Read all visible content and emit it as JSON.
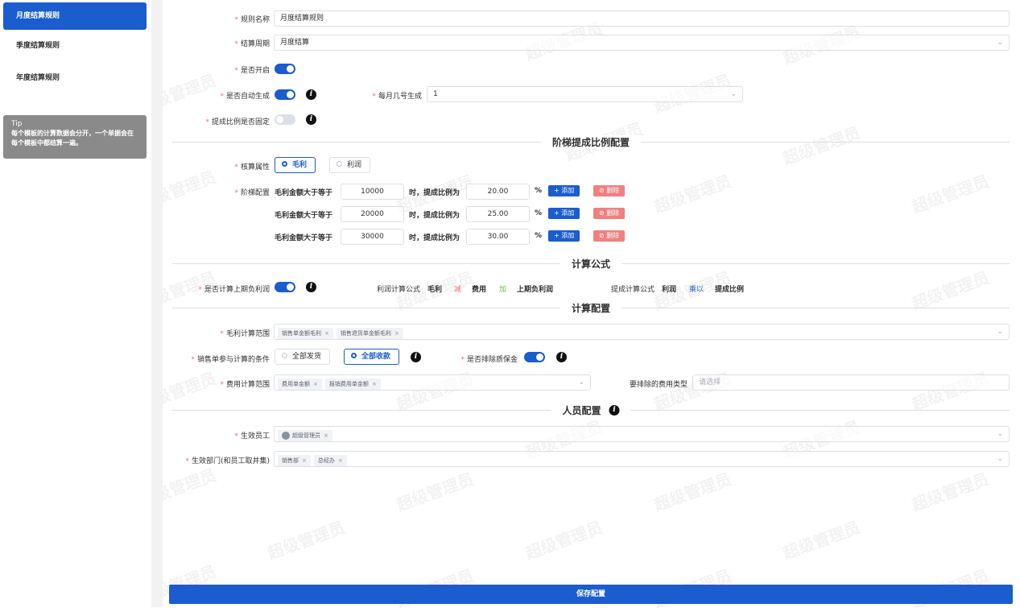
{
  "watermark": "超级管理员",
  "sidebar": {
    "items": [
      {
        "label": "月度结算规则",
        "active": true
      },
      {
        "label": "季度结算规则",
        "active": false
      },
      {
        "label": "年度结算规则",
        "active": false
      }
    ],
    "tip": {
      "title": "Tip",
      "text": "每个模板的计算数据会分开，一个单据会在每个模板中都结算一遍。"
    }
  },
  "form": {
    "rule_name": {
      "label": "规则名称",
      "value": "月度结算规则"
    },
    "period": {
      "label": "结算周期",
      "value": "月度结算"
    },
    "enabled": {
      "label": "是否开启",
      "on": true
    },
    "auto_generate": {
      "label": "是否自动生成",
      "on": true
    },
    "day_of_month": {
      "label": "每月几号生成",
      "value": "1"
    },
    "ratio_fixed": {
      "label": "提成比例是否固定",
      "on": false
    }
  },
  "tier_section": {
    "title": "阶梯提成比例配置",
    "attr_label": "核算属性",
    "options": [
      {
        "label": "毛利",
        "selected": true
      },
      {
        "label": "利润",
        "selected": false
      }
    ],
    "tier_label": "阶梯配置",
    "prefix": "毛利金额大于等于",
    "middle": "时，提成比例为",
    "suffix": "%",
    "add_label": "+ 添加",
    "delete_label": "⊘ 删除",
    "tiers": [
      {
        "amount": "10000",
        "ratio": "20.00"
      },
      {
        "amount": "20000",
        "ratio": "25.00"
      },
      {
        "amount": "30000",
        "ratio": "30.00"
      }
    ]
  },
  "formula_section": {
    "title": "计算公式",
    "prev_loss_label": "是否计算上期负利润",
    "prev_loss_on": true,
    "profit_formula": {
      "label": "利润计算公式",
      "a": "毛利",
      "op1": "减",
      "b": "费用",
      "op2": "加",
      "c": "上期负利润"
    },
    "commission_formula": {
      "label": "提成计算公式",
      "a": "利润",
      "op": "乘以",
      "b": "提成比例"
    }
  },
  "calc_section": {
    "title": "计算配置",
    "gross_range": {
      "label": "毛利计算范围",
      "tags": [
        "销售单金额毛利",
        "销售退货单金额毛利"
      ]
    },
    "condition": {
      "label": "销售单参与计算的条件",
      "options": [
        {
          "label": "全部发货",
          "selected": false
        },
        {
          "label": "全部收款",
          "selected": true
        }
      ]
    },
    "exclude_deposit": {
      "label": "是否排除质保金",
      "on": true
    },
    "expense_range": {
      "label": "费用计算范围",
      "tags": [
        "费用单金额",
        "报销费用单金额"
      ]
    },
    "exclude_expense": {
      "label": "要排除的费用类型",
      "placeholder": "请选择"
    }
  },
  "staff_section": {
    "title": "人员配置",
    "employees": {
      "label": "生效员工",
      "tags": [
        "超级管理员"
      ]
    },
    "departments": {
      "label": "生效部门(和员工取并集)",
      "tags": [
        "销售部",
        "总经办"
      ]
    }
  },
  "save_label": "保存配置",
  "colors": {
    "primary": "#1b5ccf",
    "danger": "#f08080",
    "required": "#f56c6c"
  }
}
